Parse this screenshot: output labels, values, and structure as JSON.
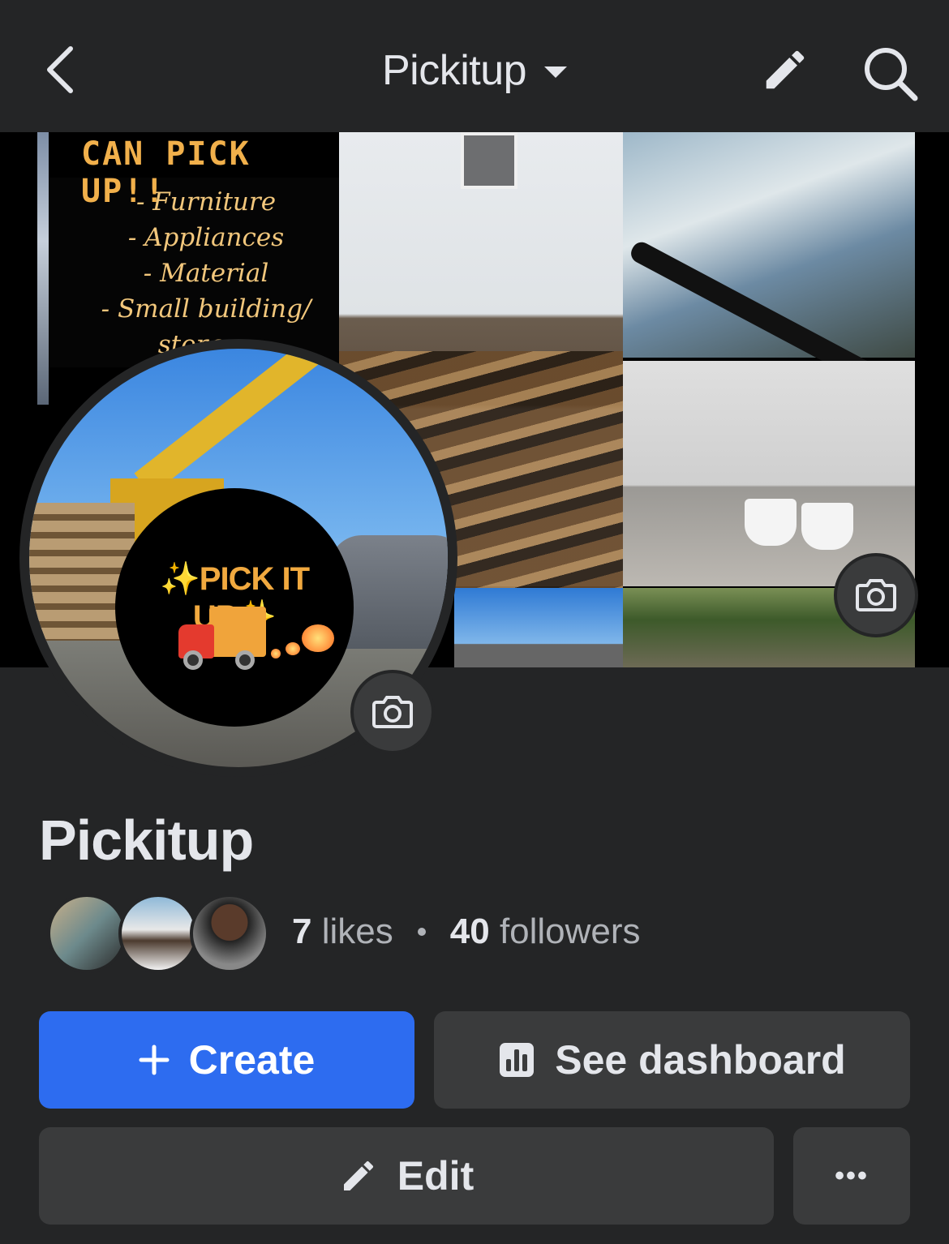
{
  "header": {
    "title": "Pickitup",
    "back_icon": "chevron-left-icon",
    "edit_icon": "pencil-icon",
    "search_icon": "search-icon"
  },
  "cover": {
    "flyer_title": "CAN PICK UP!!",
    "flyer_items": [
      "- Furniture",
      "- Appliances",
      "- Material",
      "- Small building/",
      "storage"
    ]
  },
  "avatar": {
    "logo_text": "✨PICK IT UP✨"
  },
  "page": {
    "name": "Pickitup",
    "likes_count": "7",
    "likes_label": "likes",
    "followers_count": "40",
    "followers_label": "followers"
  },
  "actions": {
    "create_label": "Create",
    "dashboard_label": "See dashboard",
    "edit_label": "Edit",
    "more_label": "•••"
  },
  "colors": {
    "background": "#242526",
    "primary_button": "#2d6cf0",
    "secondary_button": "#3a3b3c",
    "text_primary": "#e4e6eb",
    "text_secondary": "#b0b3b8"
  }
}
